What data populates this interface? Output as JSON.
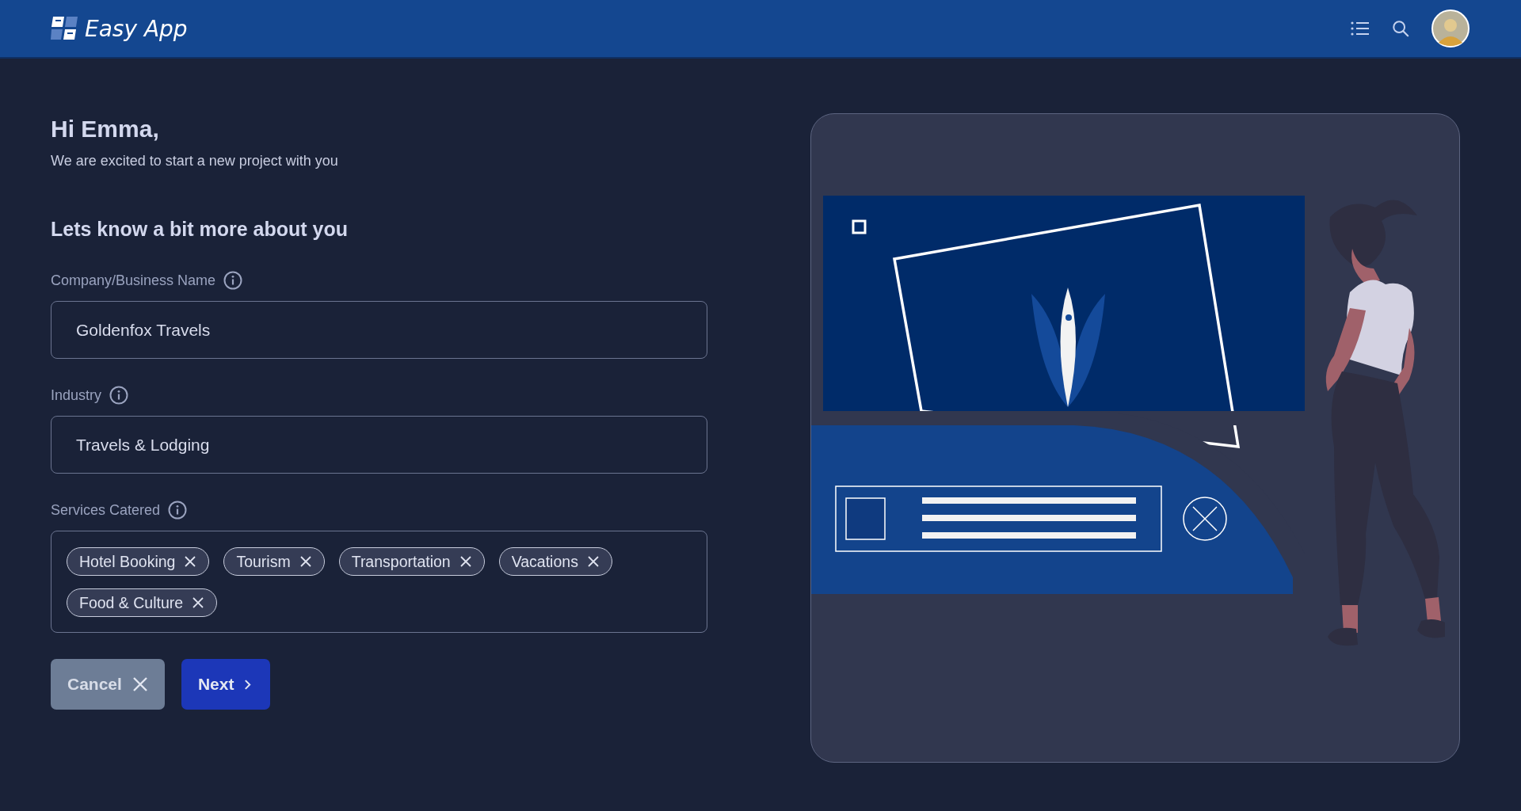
{
  "header": {
    "app_name": "Easy App"
  },
  "greeting": "Hi Emma,",
  "subtitle": "We are excited to start a new project with you",
  "section_title": "Lets know a bit more about you",
  "fields": [
    {
      "kind": "text",
      "label": "Company/Business Name",
      "value": "Goldenfox Travels"
    },
    {
      "kind": "text",
      "label": "Industry",
      "value": "Travels & Lodging"
    },
    {
      "kind": "tags",
      "label": "Services Catered",
      "tags": [
        "Hotel Booking",
        "Tourism",
        "Transportation",
        "Vacations",
        "Food & Culture"
      ]
    }
  ],
  "buttons": [
    {
      "kind": "cancel",
      "label": "Cancel"
    },
    {
      "kind": "next",
      "label": "Next"
    }
  ]
}
